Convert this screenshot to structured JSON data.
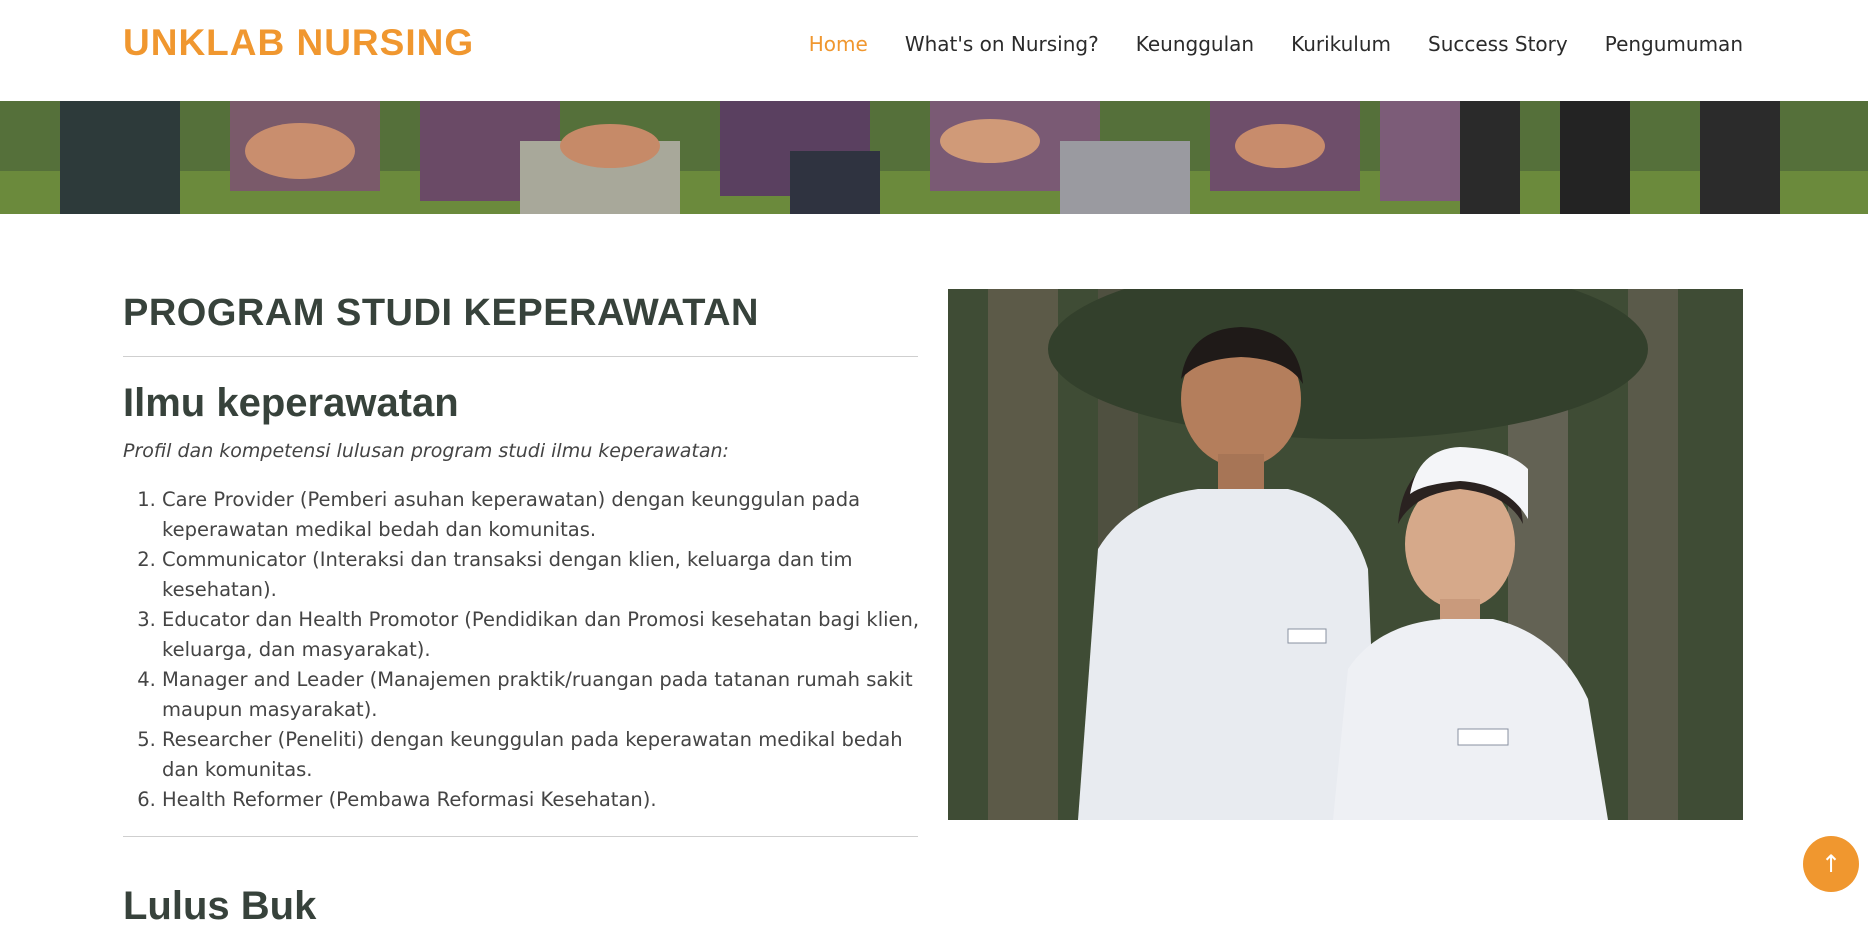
{
  "header": {
    "logo": "UNKLAB NURSING",
    "nav": [
      {
        "label": "Home",
        "active": true
      },
      {
        "label": "What's on Nursing?",
        "active": false
      },
      {
        "label": "Keunggulan",
        "active": false
      },
      {
        "label": "Kurikulum",
        "active": false
      },
      {
        "label": "Success Story",
        "active": false
      },
      {
        "label": "Pengumuman",
        "active": false
      }
    ]
  },
  "main": {
    "section_title": "PROGRAM STUDI KEPERAWATAN",
    "subheading": "Ilmu keperawatan",
    "intro": "Profil dan kompetensi lulusan program studi ilmu keperawatan:",
    "competencies": [
      "Care Provider (Pemberi asuhan keperawatan) dengan keunggulan pada keperawatan medikal bedah dan komunitas.",
      "Communicator (Interaksi dan transaksi dengan klien, keluarga dan tim kesehatan).",
      "Educator dan Health Promotor (Pendidikan dan Promosi kesehatan bagi klien, keluarga, dan masyarakat).",
      "Manager and Leader (Manajemen praktik/ruangan pada tatanan rumah sakit maupun masyarakat).",
      "Researcher (Peneliti) dengan keunggulan pada keperawatan medikal bedah dan komunitas.",
      "Health Reformer (Pembawa Reformasi Kesehatan)."
    ],
    "next_heading_partial": "Lulus Buk"
  },
  "colors": {
    "accent": "#f0972f",
    "heading": "#37423b",
    "text": "#444444"
  },
  "icons": {
    "back_to_top": "arrow-up-icon"
  }
}
